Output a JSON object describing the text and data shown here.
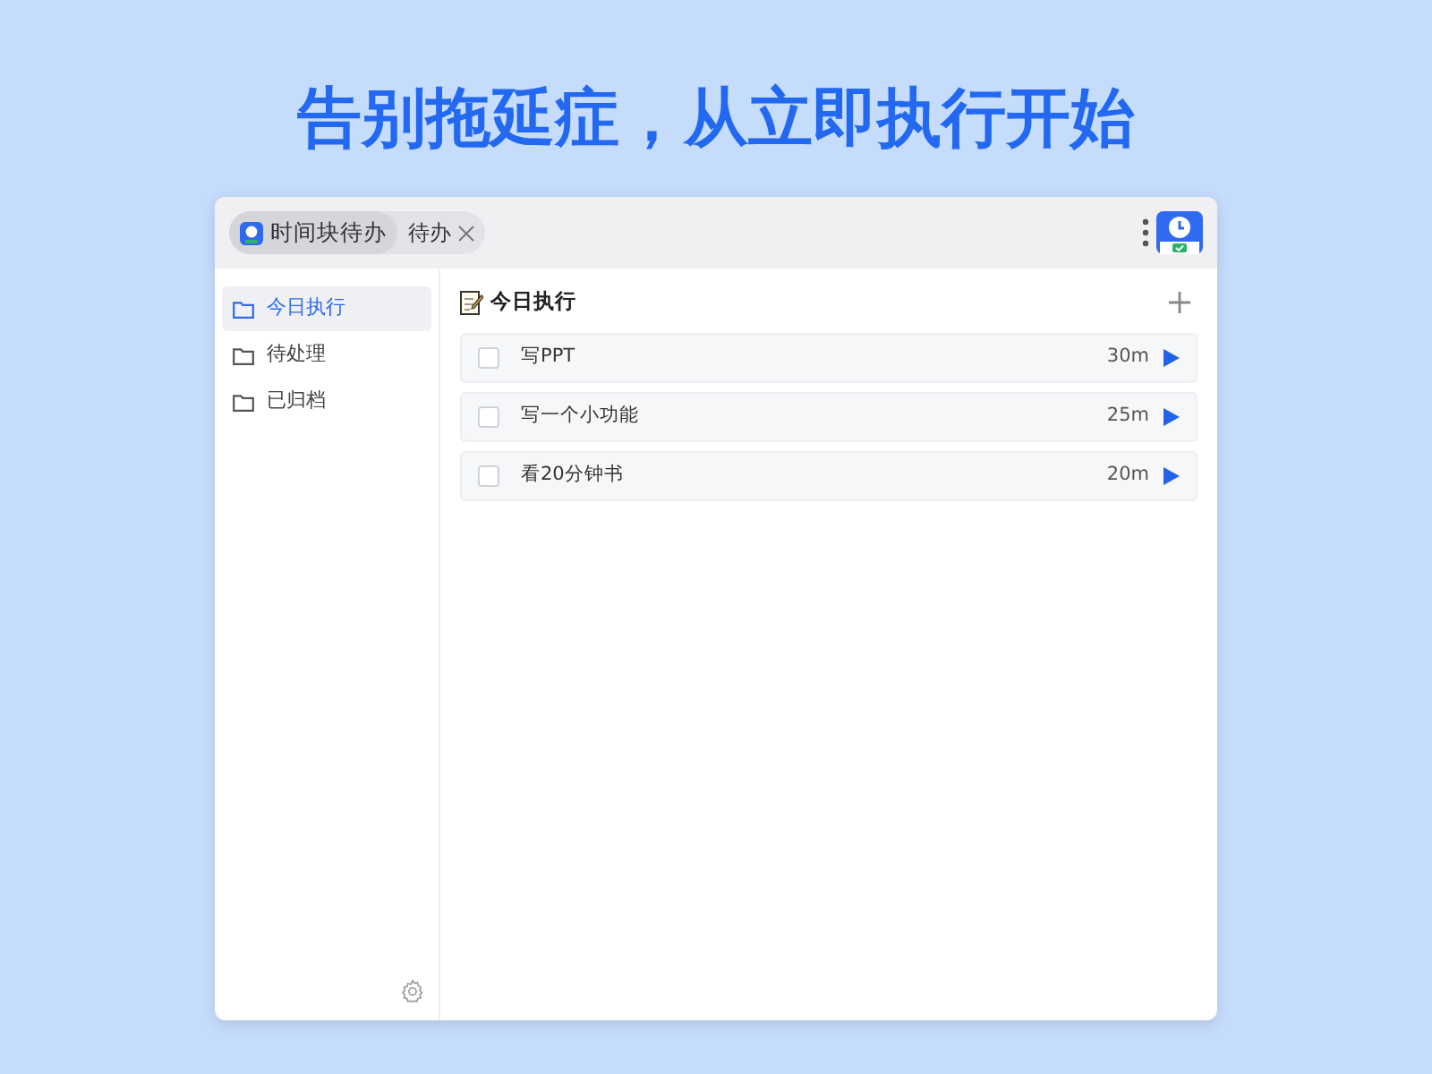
{
  "headline": "告别拖延症，从立即执行开始",
  "tabs": [
    {
      "label": "时间块待办",
      "selected": true,
      "kind": "app"
    },
    {
      "label": "待办",
      "selected": false,
      "kind": "page"
    }
  ],
  "sidebar": {
    "items": [
      {
        "label": "今日执行",
        "selected": true
      },
      {
        "label": "待处理",
        "selected": false
      },
      {
        "label": "已归档",
        "selected": false
      }
    ]
  },
  "main": {
    "title": "今日执行",
    "tasks": [
      {
        "title": "写PPT",
        "checked": false,
        "duration": "30m"
      },
      {
        "title": "写一个小功能",
        "checked": false,
        "duration": "25m"
      },
      {
        "title": "看20分钟书",
        "checked": false,
        "duration": "20m"
      }
    ]
  }
}
